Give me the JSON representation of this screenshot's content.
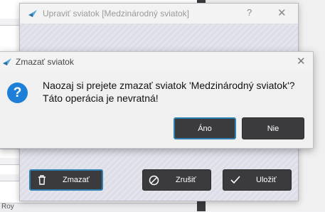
{
  "edit_dialog": {
    "title": "Upraviť sviatok [Medzinárodný sviatok]",
    "help_glyph": "?",
    "close_glyph": "✕",
    "delete_label": "Zmazať",
    "cancel_label": "Zrušiť",
    "save_label": "Uložiť"
  },
  "confirm_dialog": {
    "title": "Zmazať sviatok",
    "close_glyph": "✕",
    "message_line1": "Naozaj si prejete zmazať sviatok 'Medzinárodný sviatok'?",
    "message_line2": "Táto operácia je nevratná!",
    "question_glyph": "?",
    "yes_label": "Áno",
    "no_label": "Nie"
  },
  "background": {
    "bottom_text": "Roy"
  },
  "colors": {
    "accent": "#2d7fb0",
    "button_dark": "#3b3b3e",
    "question_icon": "#1e7fd8"
  }
}
